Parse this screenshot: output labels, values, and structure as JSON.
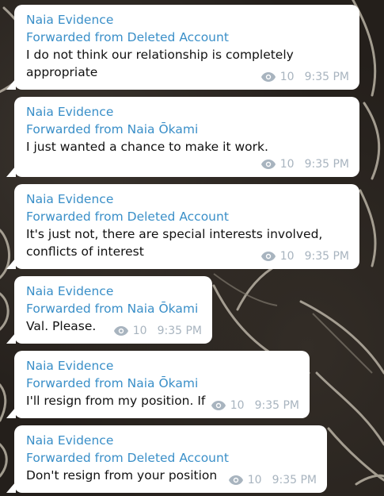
{
  "messages": [
    {
      "sender": "Naia Evidence",
      "forwarded": "Forwarded from Deleted Account",
      "text": "I do not think our relationship is completely appropriate",
      "views": "10",
      "time": "9:35 PM"
    },
    {
      "sender": "Naia Evidence",
      "forwarded": "Forwarded from Naia Ōkami",
      "text": "I just wanted a chance to make it work.",
      "views": "10",
      "time": "9:35 PM"
    },
    {
      "sender": "Naia Evidence",
      "forwarded": "Forwarded from Deleted Account",
      "text": "It's just not, there are special interests involved, conflicts of interest",
      "views": "10",
      "time": "9:35 PM"
    },
    {
      "sender": "Naia Evidence",
      "forwarded": "Forwarded from Naia Ōkami",
      "text": "Val. Please.",
      "views": "10",
      "time": "9:35 PM"
    },
    {
      "sender": "Naia Evidence",
      "forwarded": "Forwarded from Naia Ōkami",
      "text": "I'll resign from my position. If",
      "views": "10",
      "time": "9:35 PM"
    },
    {
      "sender": "Naia Evidence",
      "forwarded": "Forwarded from Deleted Account",
      "text": "Don't resign from your position",
      "views": "10",
      "time": "9:35 PM"
    }
  ],
  "icons": {
    "views": "eye-icon"
  },
  "colors": {
    "bubble": "#ffffff",
    "sender": "#3a8fc8",
    "meta": "#a8b4bf",
    "text": "#111111",
    "background": "#241f1b"
  }
}
